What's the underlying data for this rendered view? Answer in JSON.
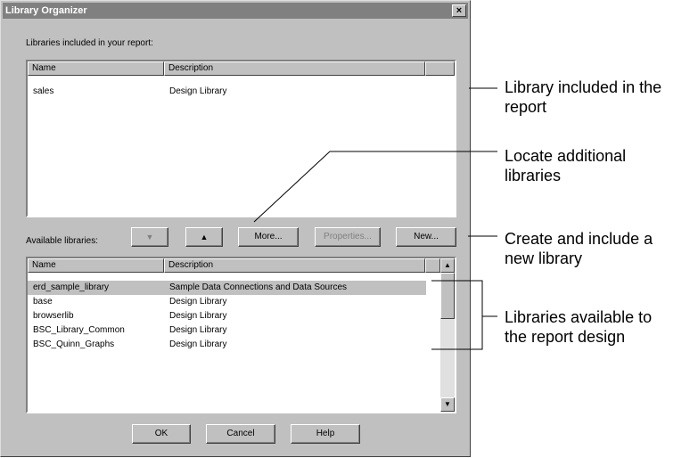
{
  "dialog": {
    "title": "Library Organizer",
    "close_label": "×",
    "included_label": "Libraries included in your report:",
    "available_label": "Available libraries:"
  },
  "included_list": {
    "columns": [
      "Name",
      "Description"
    ],
    "rows": [
      {
        "name": "sales",
        "description": "Design Library"
      }
    ]
  },
  "available_list": {
    "columns": [
      "Name",
      "Description"
    ],
    "rows": [
      {
        "name": "erd_sample_library",
        "description": "Sample Data Connections and Data Sources",
        "selected": true
      },
      {
        "name": "base",
        "description": "Design Library"
      },
      {
        "name": "browserlib",
        "description": "Design Library"
      },
      {
        "name": "BSC_Library_Common",
        "description": "Design Library"
      },
      {
        "name": "BSC_Quinn_Graphs",
        "description": "Design Library"
      }
    ]
  },
  "buttons": {
    "down": "▼",
    "up": "▲",
    "more": "More...",
    "properties": "Properties...",
    "new": "New...",
    "ok": "OK",
    "cancel": "Cancel",
    "help": "Help"
  },
  "scrollbar": {
    "up_arrow": "▲",
    "down_arrow": "▼"
  },
  "callouts": {
    "included": [
      "Library included in the",
      "report"
    ],
    "locate": [
      "Locate additional",
      "libraries"
    ],
    "create": [
      "Create and include a",
      "new library"
    ],
    "available": [
      "Libraries available to",
      "the report design"
    ]
  }
}
